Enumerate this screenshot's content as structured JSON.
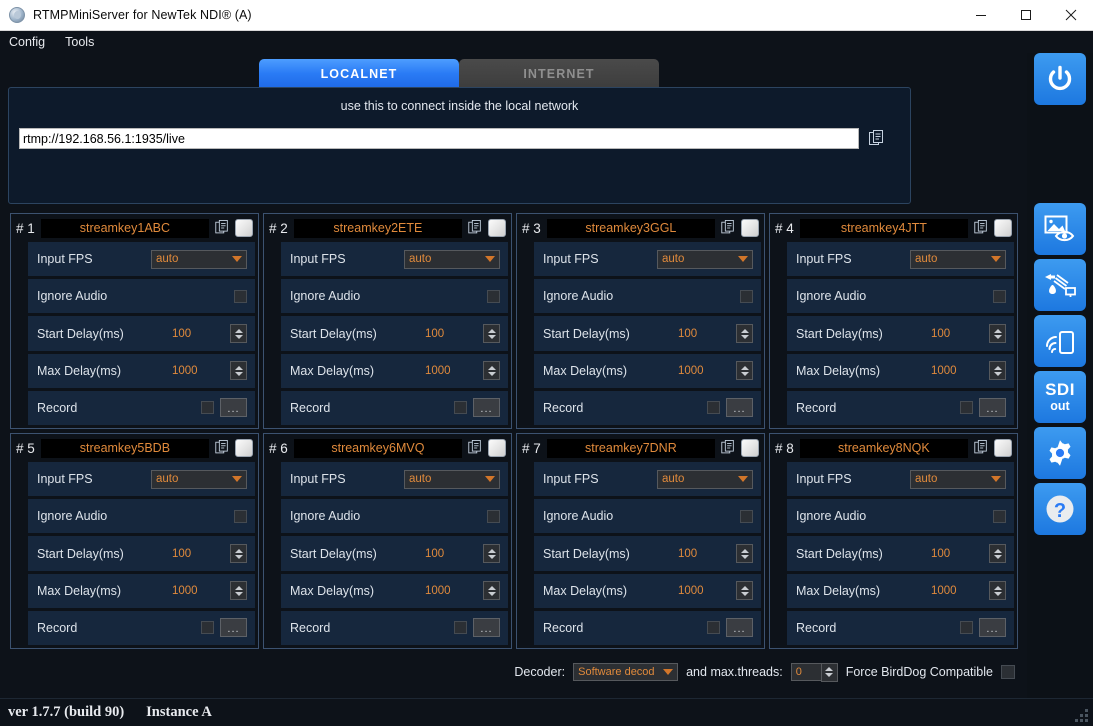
{
  "window": {
    "title": "RTMPMiniServer for NewTek NDI® (A)",
    "app_icon": "disc-icon",
    "controls": {
      "minimize": "minimize-icon",
      "maximize": "maximize-icon",
      "close": "close-icon"
    }
  },
  "menubar": {
    "items": [
      "Config",
      "Tools"
    ]
  },
  "tabs": [
    {
      "label": "LOCALNET",
      "active": true
    },
    {
      "label": "INTERNET",
      "active": false
    }
  ],
  "url_panel": {
    "hint": "use this to connect inside the local network",
    "url_value": "rtmp://192.168.56.1:1935/live",
    "copy_icon": "copy-document-icon"
  },
  "row_labels": {
    "input_fps": "Input FPS",
    "ignore_audio": "Ignore Audio",
    "start_delay": "Start Delay(ms)",
    "max_delay": "Max Delay(ms)",
    "record": "Record",
    "browse": "..."
  },
  "channels": [
    {
      "num": "# 1",
      "key": "streamkey1ABC",
      "fps": "auto",
      "start_delay": "100",
      "max_delay": "1000"
    },
    {
      "num": "# 2",
      "key": "streamkey2ETE",
      "fps": "auto",
      "start_delay": "100",
      "max_delay": "1000"
    },
    {
      "num": "# 3",
      "key": "streamkey3GGL",
      "fps": "auto",
      "start_delay": "100",
      "max_delay": "1000"
    },
    {
      "num": "# 4",
      "key": "streamkey4JTT",
      "fps": "auto",
      "start_delay": "100",
      "max_delay": "1000"
    },
    {
      "num": "# 5",
      "key": "streamkey5BDB",
      "fps": "auto",
      "start_delay": "100",
      "max_delay": "1000"
    },
    {
      "num": "# 6",
      "key": "streamkey6MVQ",
      "fps": "auto",
      "start_delay": "100",
      "max_delay": "1000"
    },
    {
      "num": "# 7",
      "key": "streamkey7DNR",
      "fps": "auto",
      "start_delay": "100",
      "max_delay": "1000"
    },
    {
      "num": "# 8",
      "key": "streamkey8NQK",
      "fps": "auto",
      "start_delay": "100",
      "max_delay": "1000"
    }
  ],
  "decoder_bar": {
    "decoder_label": "Decoder:",
    "decoder_value": "Software decod",
    "threads_label": "and max.threads:",
    "threads_value": "0",
    "force_label": "Force BirdDog Compatible"
  },
  "sidebar": [
    {
      "name": "power-button",
      "icon": "power-icon",
      "label": ""
    },
    {
      "name": "preview-button",
      "icon": "image-preview-icon",
      "label": ""
    },
    {
      "name": "tools-button",
      "icon": "tools-icon",
      "label": ""
    },
    {
      "name": "mobile-button",
      "icon": "mobile-stream-icon",
      "label": ""
    },
    {
      "name": "sdi-out-button",
      "icon": "sdi-out-icon",
      "label_top": "SDI",
      "label_bottom": "out"
    },
    {
      "name": "settings-button",
      "icon": "gear-icon",
      "label": ""
    },
    {
      "name": "help-button",
      "icon": "question-mark-icon",
      "label": ""
    }
  ],
  "statusbar": {
    "version": "ver 1.7.7 (build 90)",
    "instance": "Instance A"
  },
  "colors": {
    "accent_blue": "#2a7bf5",
    "orange_value": "#e08a3c",
    "panel_bg": "#0d1219",
    "row_bg": "#16273d",
    "panel_border": "#3c5270",
    "url_panel_bg": "#0d1a2b"
  }
}
